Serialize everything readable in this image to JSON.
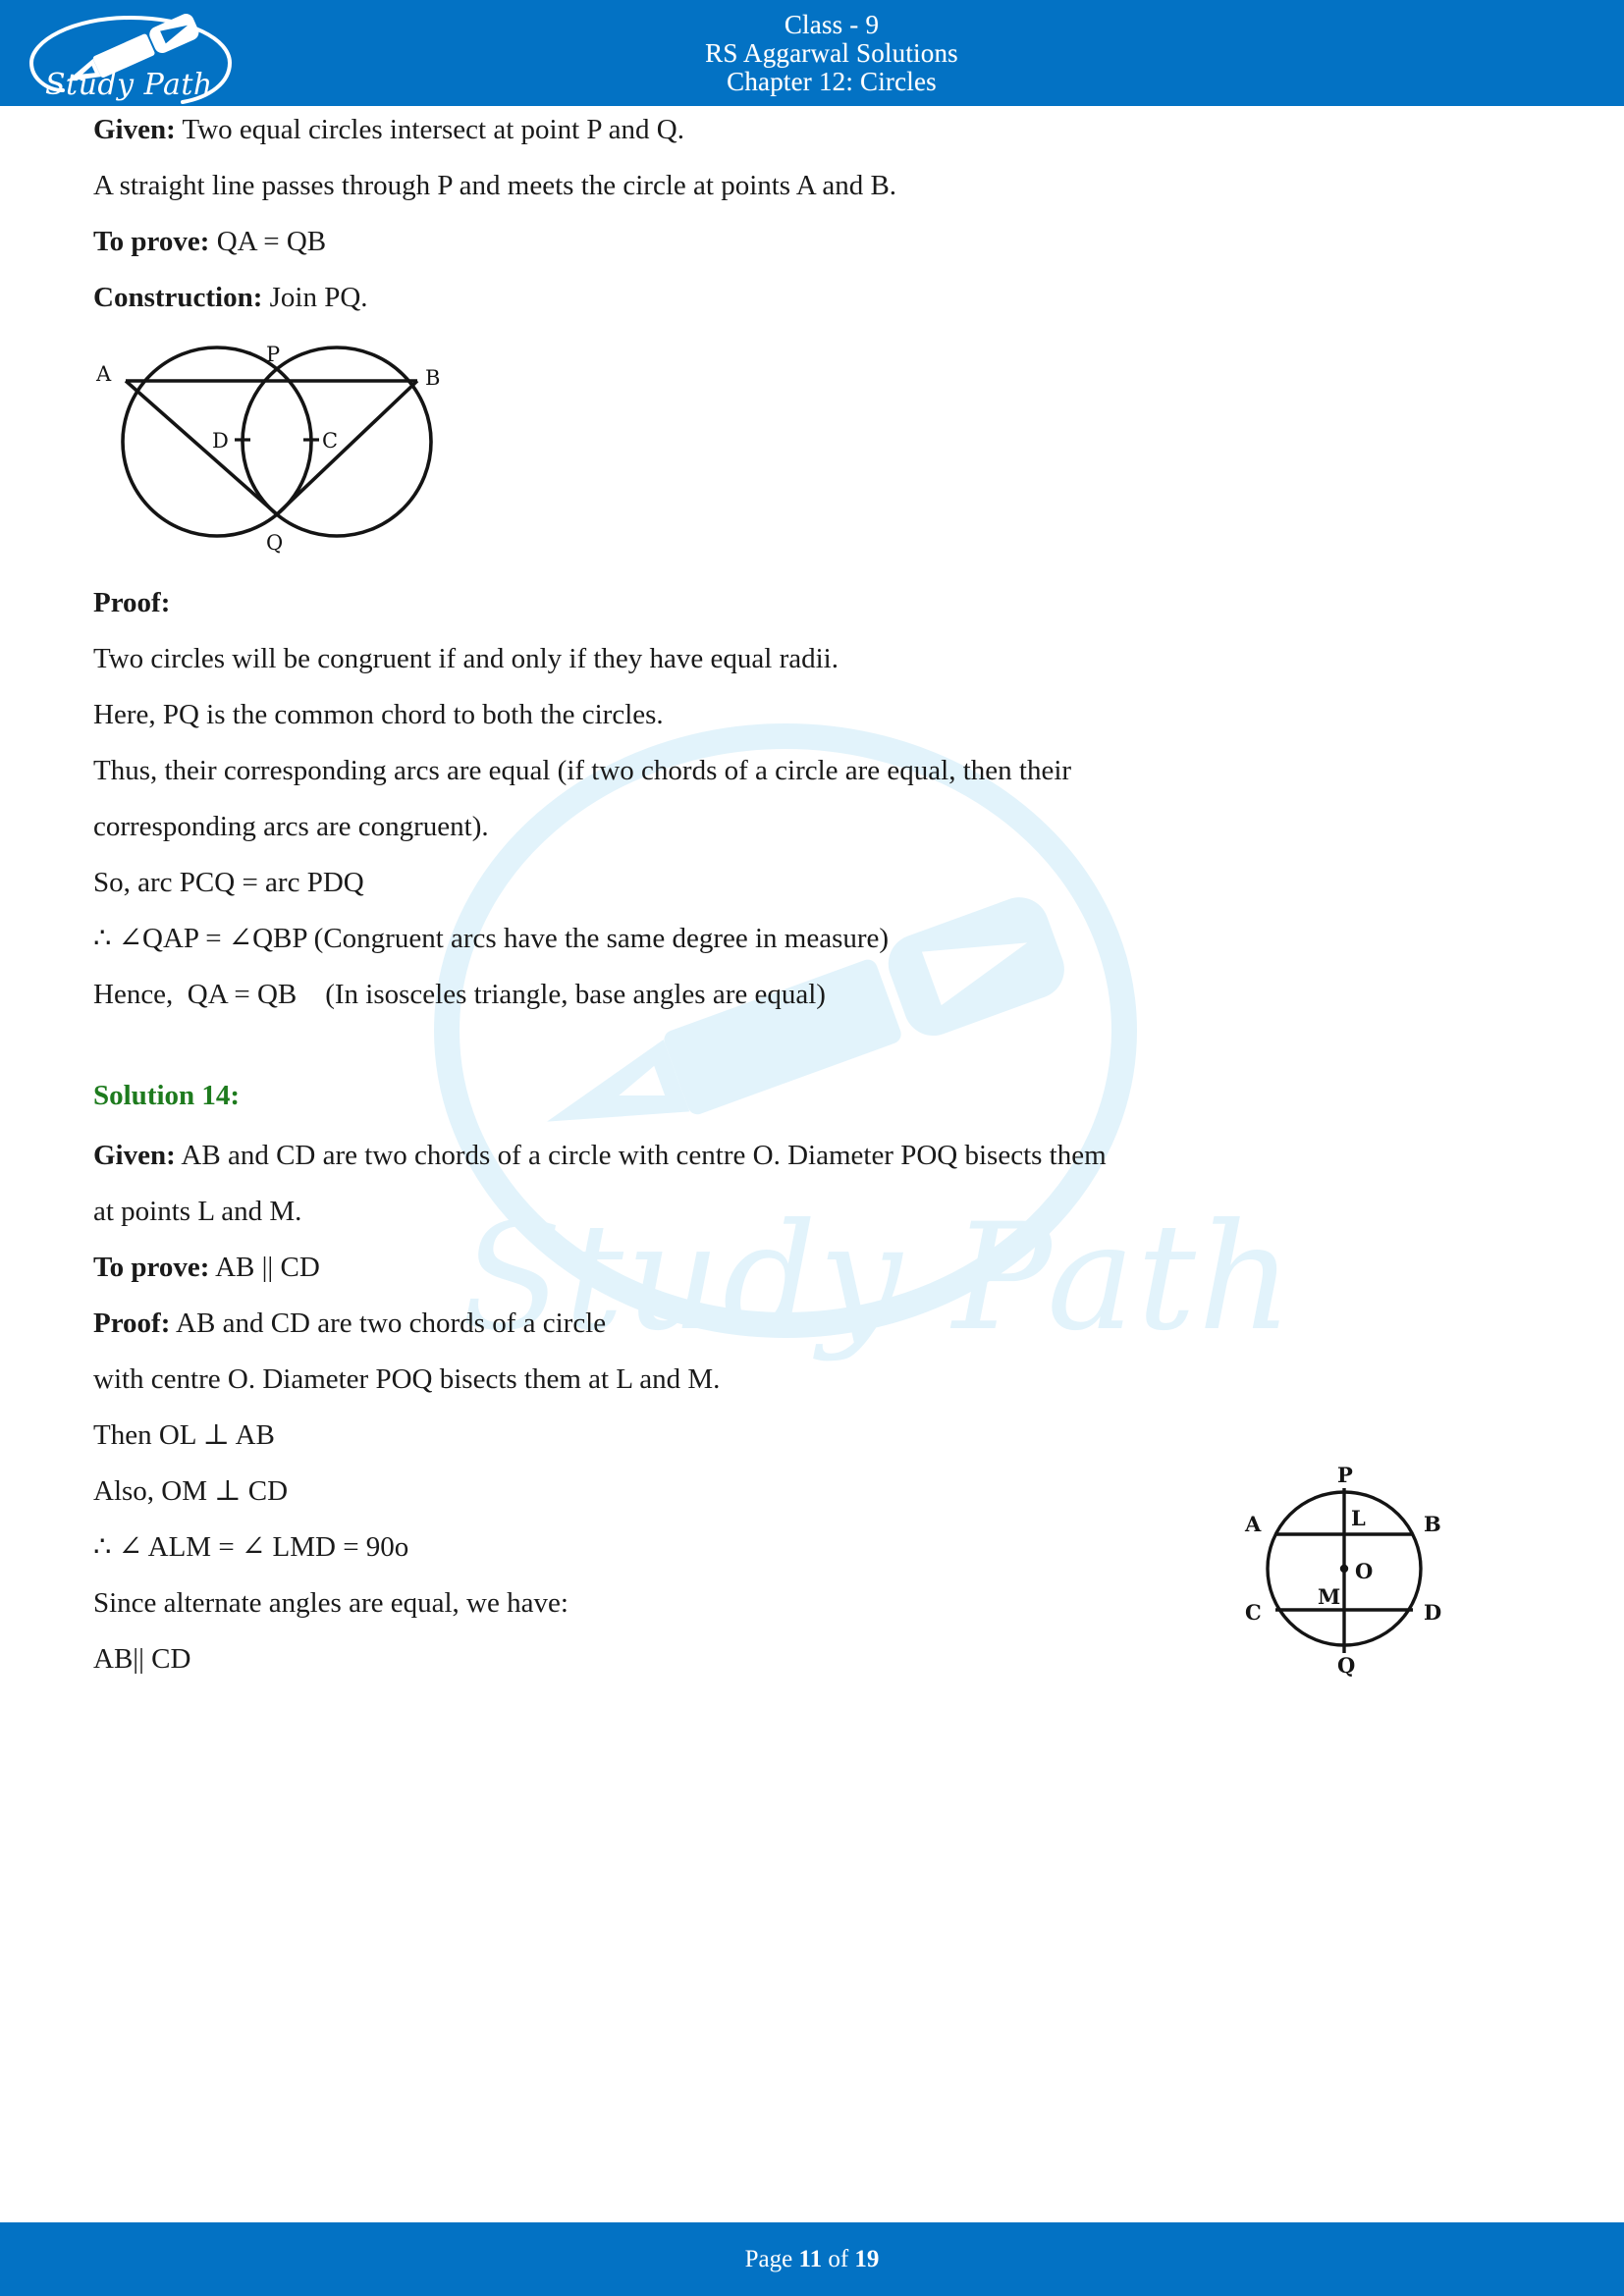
{
  "header": {
    "logo_alt": "Study Path",
    "logo_text": "Study Path",
    "line1": "Class - 9",
    "line2": "RS Aggarwal Solutions",
    "line3": "Chapter 12: Circles",
    "bg_color": "#0372c4",
    "text_color": "#ffffff"
  },
  "watermark": {
    "text": "Study Path",
    "color": "#e2f3fb"
  },
  "solution_13": {
    "given_label": "Given:",
    "given_text": " Two equal circles intersect at point P and Q.",
    "line_2": "A straight line passes through P and meets the circle at points A and B.",
    "to_prove_label": "To prove:",
    "to_prove_text": " QA = QB",
    "construction_label": "Construction:",
    "construction_text": " Join PQ.",
    "proof_label": "Proof:",
    "proof_lines": [
      "Two circles will be congruent if and only if they have equal radii.",
      "Here, PQ is the common chord to both the circles.",
      "Thus, their corresponding arcs are equal (if two chords of a circle are equal, then their",
      "corresponding arcs are congruent).",
      "So, arc PCQ = arc PDQ",
      "∴ ∠QAP = ∠QBP (Congruent arcs have the same degree in measure)",
      "Hence,  QA = QB    (In isosceles triangle, base angles are equal)"
    ],
    "figure": {
      "name": "two-intersecting-circles-diagram",
      "labels": [
        "A",
        "P",
        "B",
        "D",
        "C",
        "Q"
      ]
    }
  },
  "solution_14": {
    "heading": "Solution 14:",
    "heading_color": "#1e7b1e",
    "given_label": "Given:",
    "given_text": " AB and CD are two chords of a circle with centre O. Diameter POQ bisects them",
    "given_text_2": "at points L and M.",
    "to_prove_label": "To prove:",
    "to_prove_text": " AB || CD",
    "proof_label": "Proof:",
    "proof_text": " AB and CD are two chords of a circle",
    "proof_lines": [
      "with centre O. Diameter POQ bisects them at L and M.",
      "Then OL ⊥ AB",
      "Also, OM ⊥ CD",
      "∴ ∠ ALM = ∠ LMD = 90o",
      "Since alternate angles are equal, we have:",
      "AB|| CD"
    ],
    "figure": {
      "name": "circle-with-two-chords-diagram",
      "labels": [
        "P",
        "A",
        "L",
        "B",
        "O",
        "C",
        "M",
        "D",
        "Q"
      ]
    }
  },
  "footer": {
    "prefix": "Page ",
    "current_page": "11",
    "middle": " of ",
    "total_pages": "19",
    "bg_color": "#0372c4"
  }
}
